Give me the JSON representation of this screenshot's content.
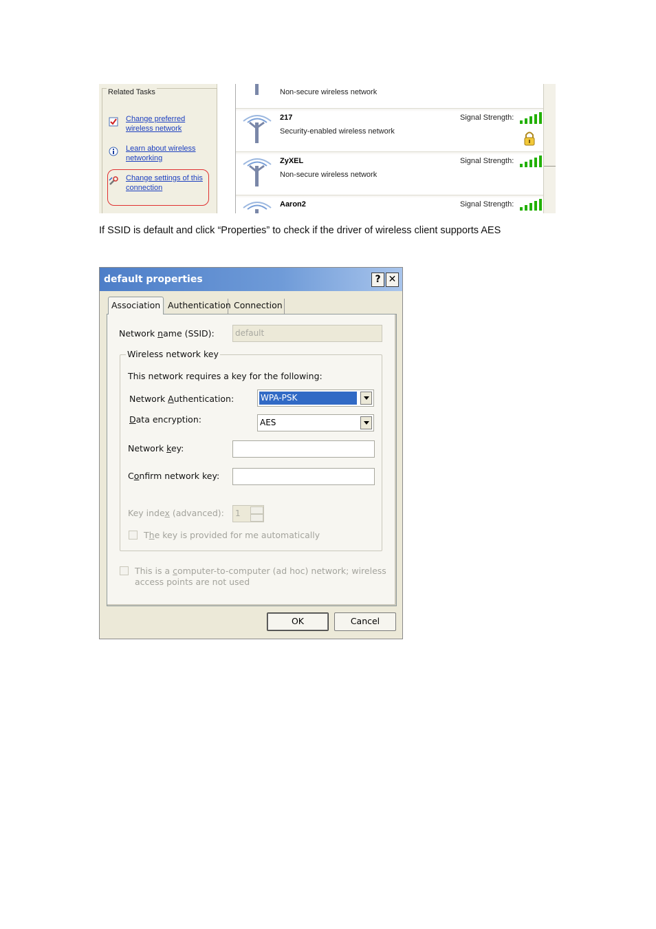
{
  "related_tasks": {
    "title": "Related Tasks",
    "items": [
      {
        "label_line1": "Change preferred",
        "label_line2": "wireless network",
        "icon": "checklist-icon"
      },
      {
        "label_line1": "Learn about wireless",
        "label_line2": "networking",
        "icon": "info-icon"
      },
      {
        "label_line1": "Change settings of this",
        "label_line2": "connection",
        "icon": "settings-wrench-icon"
      }
    ]
  },
  "networks": {
    "top_partial": {
      "desc": "Non-secure wireless network"
    },
    "items": [
      {
        "name": "217",
        "desc": "Security-enabled wireless network",
        "signal_label": "Signal Strength:",
        "secured": true
      },
      {
        "name": "ZyXEL",
        "desc": "Non-secure wireless network",
        "signal_label": "Signal Strength:",
        "secured": false
      },
      {
        "name": "Aaron2",
        "desc": "",
        "signal_label": "Signal Strength:",
        "secured": false
      }
    ],
    "signal_color": "#22b000"
  },
  "caption": "If SSID is default and click “Properties” to check if the driver of wireless client supports AES",
  "dialog": {
    "title": "default properties",
    "help_label": "?",
    "close_label": "✕",
    "tabs": [
      "Association",
      "Authentication",
      "Connection"
    ],
    "ssid_label_pre": "Network ",
    "ssid_label_key": "n",
    "ssid_label_post": "ame (SSID):",
    "ssid_value": "default",
    "group_title": "Wireless network key",
    "requires_text": "This network requires a key for the following:",
    "auth_label_pre": "Network ",
    "auth_label_key": "A",
    "auth_label_post": "uthentication:",
    "auth_value": "WPA-PSK",
    "enc_label_key": "D",
    "enc_label_post": "ata encryption:",
    "enc_value": "AES",
    "netkey_label_pre": "Network ",
    "netkey_label_key": "k",
    "netkey_label_post": "ey:",
    "confirm_label_pre": "C",
    "confirm_label_key": "o",
    "confirm_label_post": "nfirm network key:",
    "keyindex_label_pre": "Key inde",
    "keyindex_label_key": "x",
    "keyindex_label_post": " (advanced):",
    "keyindex_value": "1",
    "auto_key_pre": "T",
    "auto_key_key": "h",
    "auto_key_post": "e key is provided for me automatically",
    "adhoc_pre": "This is a ",
    "adhoc_key": "c",
    "adhoc_line1_post": "omputer-to-computer (ad hoc) network; wireless",
    "adhoc_line2": "access points are not used",
    "ok_label": "OK",
    "cancel_label": "Cancel",
    "titlebar_color": "#4d7ec8",
    "selection_color": "#316ac5"
  }
}
